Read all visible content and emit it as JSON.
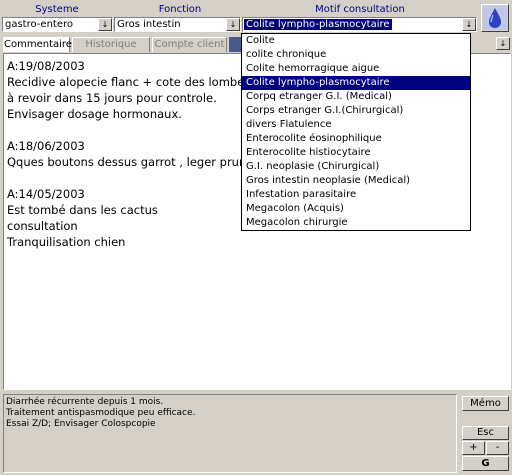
{
  "headers": {
    "systeme": "Systeme",
    "fonction": "Fonction",
    "motif": "Motif consultation"
  },
  "combos": {
    "systeme_value": "gastro-entero",
    "fonction_value": "Gros intestin",
    "motif_value": "Colite lympho-plasmocytaire"
  },
  "tabs": [
    "Commentaire",
    "Historique",
    "Compte client"
  ],
  "entries": [
    {
      "date": "A:19/08/2003",
      "lines": [
        "Recidive alopecie flanc + cote des lombes",
        "à revoir dans 15 jours pour controle.",
        "Envisager dosage hormonaux."
      ]
    },
    {
      "date": "A:18/06/2003",
      "lines": [
        "Qques boutons dessus garrot , leger prurit"
      ]
    },
    {
      "date": "A:14/05/2003",
      "lines": [
        "Est tombé dans les cactus",
        "consultation",
        "Tranquilisation chien"
      ]
    }
  ],
  "dropdown": {
    "selected_index": 3,
    "items": [
      "Colite",
      "colite chronique",
      "Colite hemorragique aigue",
      "Colite lympho-plasmocytaire",
      "Corpq etranger G.I. (Medical)",
      "Corps etranger G.I.(Chirurgical)",
      "divers Flatulence",
      "Enterocolite éosinophilique",
      "Enterocolite histiocytaire",
      "G.I. neoplasie (Chirurgical)",
      "Gros intestin neoplasie (Medical)",
      "Infestation parasitaire",
      "Megacolon (Acquis)",
      "Megacolon chirurgie"
    ]
  },
  "notes": [
    "Diarrhée récurrente depuis 1 mois.",
    "Traitement antispasmodique peu efficace.",
    "Essai Z/D; Envisager Colospcopie"
  ],
  "buttons": {
    "memo": "Mémo",
    "esc": "Esc",
    "plus": "+",
    "minus": "-",
    "g": "G"
  },
  "icons": {
    "combo_arrow": "↓",
    "logo": "drop-logo-icon"
  }
}
